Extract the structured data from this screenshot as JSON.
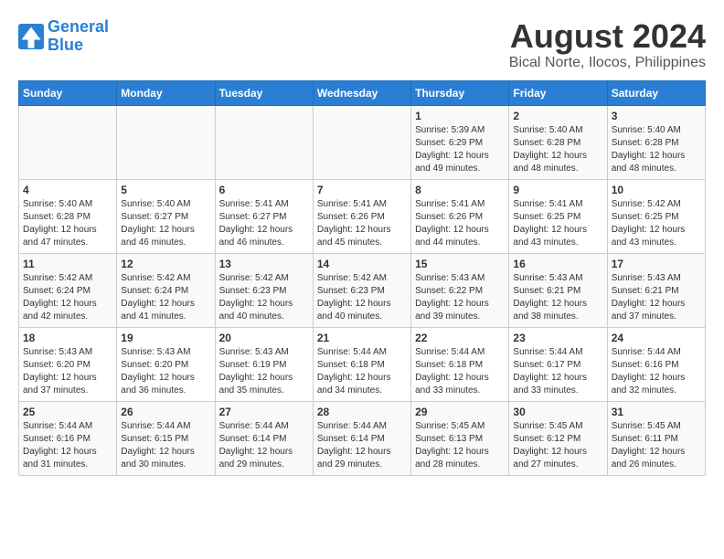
{
  "header": {
    "logo_line1": "General",
    "logo_line2": "Blue",
    "main_title": "August 2024",
    "subtitle": "Bical Norte, Ilocos, Philippines"
  },
  "calendar": {
    "days_of_week": [
      "Sunday",
      "Monday",
      "Tuesday",
      "Wednesday",
      "Thursday",
      "Friday",
      "Saturday"
    ],
    "weeks": [
      [
        {
          "day": "",
          "info": ""
        },
        {
          "day": "",
          "info": ""
        },
        {
          "day": "",
          "info": ""
        },
        {
          "day": "",
          "info": ""
        },
        {
          "day": "1",
          "info": "Sunrise: 5:39 AM\nSunset: 6:29 PM\nDaylight: 12 hours\nand 49 minutes."
        },
        {
          "day": "2",
          "info": "Sunrise: 5:40 AM\nSunset: 6:28 PM\nDaylight: 12 hours\nand 48 minutes."
        },
        {
          "day": "3",
          "info": "Sunrise: 5:40 AM\nSunset: 6:28 PM\nDaylight: 12 hours\nand 48 minutes."
        }
      ],
      [
        {
          "day": "4",
          "info": "Sunrise: 5:40 AM\nSunset: 6:28 PM\nDaylight: 12 hours\nand 47 minutes."
        },
        {
          "day": "5",
          "info": "Sunrise: 5:40 AM\nSunset: 6:27 PM\nDaylight: 12 hours\nand 46 minutes."
        },
        {
          "day": "6",
          "info": "Sunrise: 5:41 AM\nSunset: 6:27 PM\nDaylight: 12 hours\nand 46 minutes."
        },
        {
          "day": "7",
          "info": "Sunrise: 5:41 AM\nSunset: 6:26 PM\nDaylight: 12 hours\nand 45 minutes."
        },
        {
          "day": "8",
          "info": "Sunrise: 5:41 AM\nSunset: 6:26 PM\nDaylight: 12 hours\nand 44 minutes."
        },
        {
          "day": "9",
          "info": "Sunrise: 5:41 AM\nSunset: 6:25 PM\nDaylight: 12 hours\nand 43 minutes."
        },
        {
          "day": "10",
          "info": "Sunrise: 5:42 AM\nSunset: 6:25 PM\nDaylight: 12 hours\nand 43 minutes."
        }
      ],
      [
        {
          "day": "11",
          "info": "Sunrise: 5:42 AM\nSunset: 6:24 PM\nDaylight: 12 hours\nand 42 minutes."
        },
        {
          "day": "12",
          "info": "Sunrise: 5:42 AM\nSunset: 6:24 PM\nDaylight: 12 hours\nand 41 minutes."
        },
        {
          "day": "13",
          "info": "Sunrise: 5:42 AM\nSunset: 6:23 PM\nDaylight: 12 hours\nand 40 minutes."
        },
        {
          "day": "14",
          "info": "Sunrise: 5:42 AM\nSunset: 6:23 PM\nDaylight: 12 hours\nand 40 minutes."
        },
        {
          "day": "15",
          "info": "Sunrise: 5:43 AM\nSunset: 6:22 PM\nDaylight: 12 hours\nand 39 minutes."
        },
        {
          "day": "16",
          "info": "Sunrise: 5:43 AM\nSunset: 6:21 PM\nDaylight: 12 hours\nand 38 minutes."
        },
        {
          "day": "17",
          "info": "Sunrise: 5:43 AM\nSunset: 6:21 PM\nDaylight: 12 hours\nand 37 minutes."
        }
      ],
      [
        {
          "day": "18",
          "info": "Sunrise: 5:43 AM\nSunset: 6:20 PM\nDaylight: 12 hours\nand 37 minutes."
        },
        {
          "day": "19",
          "info": "Sunrise: 5:43 AM\nSunset: 6:20 PM\nDaylight: 12 hours\nand 36 minutes."
        },
        {
          "day": "20",
          "info": "Sunrise: 5:43 AM\nSunset: 6:19 PM\nDaylight: 12 hours\nand 35 minutes."
        },
        {
          "day": "21",
          "info": "Sunrise: 5:44 AM\nSunset: 6:18 PM\nDaylight: 12 hours\nand 34 minutes."
        },
        {
          "day": "22",
          "info": "Sunrise: 5:44 AM\nSunset: 6:18 PM\nDaylight: 12 hours\nand 33 minutes."
        },
        {
          "day": "23",
          "info": "Sunrise: 5:44 AM\nSunset: 6:17 PM\nDaylight: 12 hours\nand 33 minutes."
        },
        {
          "day": "24",
          "info": "Sunrise: 5:44 AM\nSunset: 6:16 PM\nDaylight: 12 hours\nand 32 minutes."
        }
      ],
      [
        {
          "day": "25",
          "info": "Sunrise: 5:44 AM\nSunset: 6:16 PM\nDaylight: 12 hours\nand 31 minutes."
        },
        {
          "day": "26",
          "info": "Sunrise: 5:44 AM\nSunset: 6:15 PM\nDaylight: 12 hours\nand 30 minutes."
        },
        {
          "day": "27",
          "info": "Sunrise: 5:44 AM\nSunset: 6:14 PM\nDaylight: 12 hours\nand 29 minutes."
        },
        {
          "day": "28",
          "info": "Sunrise: 5:44 AM\nSunset: 6:14 PM\nDaylight: 12 hours\nand 29 minutes."
        },
        {
          "day": "29",
          "info": "Sunrise: 5:45 AM\nSunset: 6:13 PM\nDaylight: 12 hours\nand 28 minutes."
        },
        {
          "day": "30",
          "info": "Sunrise: 5:45 AM\nSunset: 6:12 PM\nDaylight: 12 hours\nand 27 minutes."
        },
        {
          "day": "31",
          "info": "Sunrise: 5:45 AM\nSunset: 6:11 PM\nDaylight: 12 hours\nand 26 minutes."
        }
      ]
    ]
  }
}
